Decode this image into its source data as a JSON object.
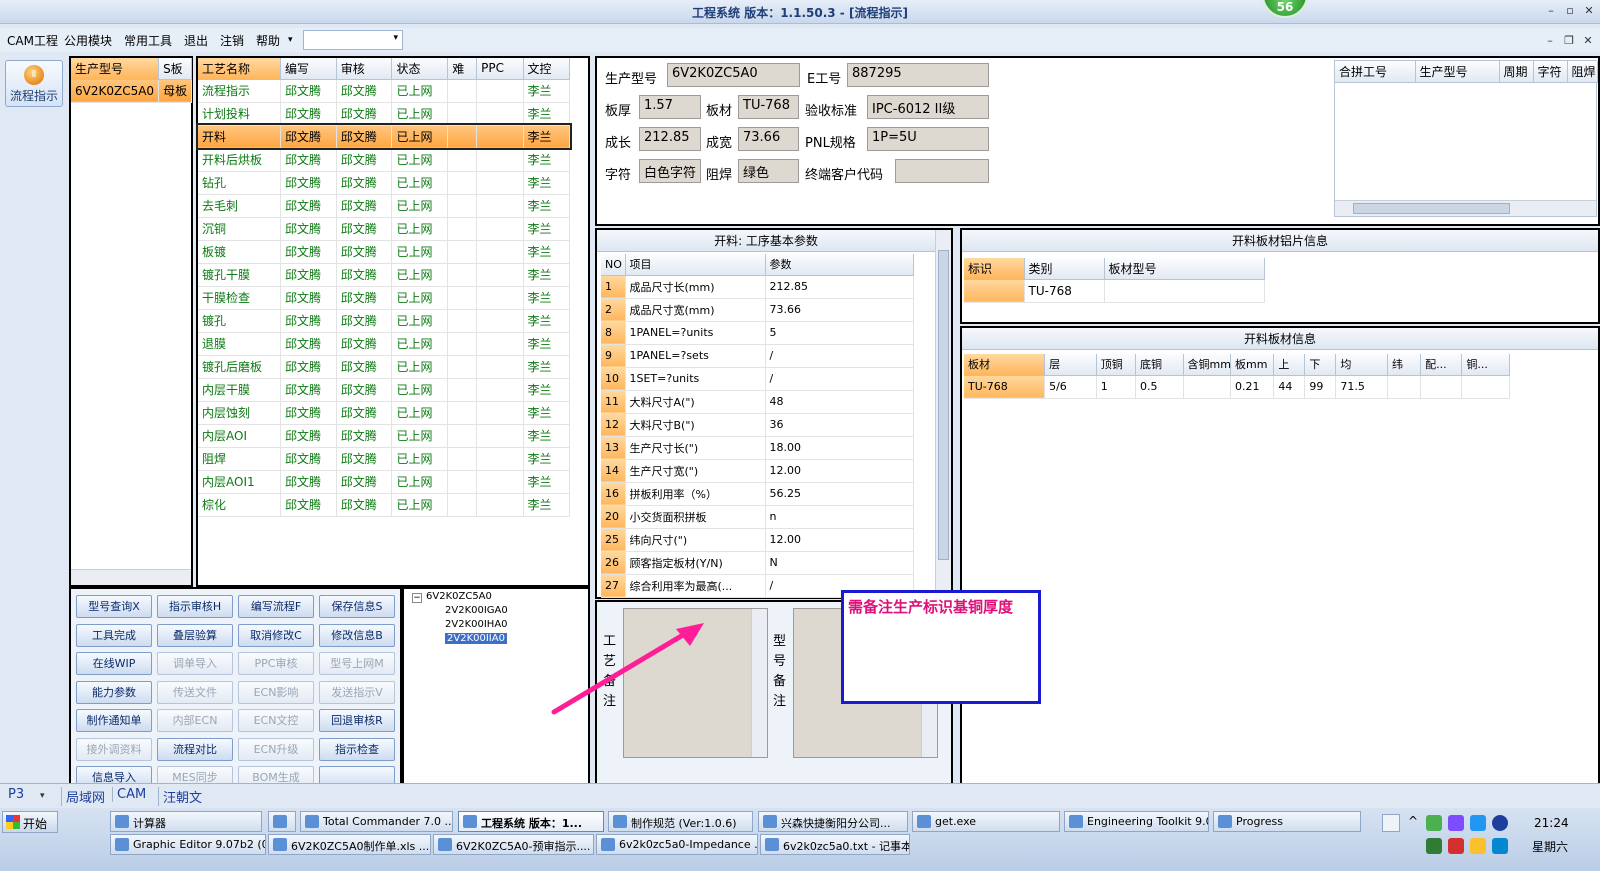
{
  "window": {
    "title": "工程系统  版本：1.1.50.3 - [流程指示]",
    "badge": "56",
    "min": "–",
    "max": "▫",
    "close": "✕",
    "inner_min": "–",
    "inner_restore": "❐",
    "inner_close": "✕"
  },
  "menu": [
    "CAM工程",
    "公用模块",
    "常用工具",
    "退出",
    "注销",
    "帮助"
  ],
  "menu_more": "▾",
  "combo": {
    "value": "",
    "arrow": "▾"
  },
  "side": {
    "label": "流程指示",
    "icon": "flow-icon"
  },
  "model_list": {
    "headers": [
      "生产型号",
      "S板"
    ],
    "rows": [
      [
        "6V2K0ZC5A0",
        "母板"
      ]
    ]
  },
  "process_table": {
    "headers": [
      "工艺名称",
      "编写",
      "审核",
      "状态",
      "难",
      "PPC",
      "文控"
    ],
    "rows": [
      [
        "流程指示",
        "邱文腾",
        "邱文腾",
        "已上网",
        "",
        "",
        "李兰"
      ],
      [
        "计划投料",
        "邱文腾",
        "邱文腾",
        "已上网",
        "",
        "",
        "李兰"
      ],
      [
        "开料",
        "邱文腾",
        "邱文腾",
        "已上网",
        "",
        "",
        "李兰"
      ],
      [
        "开料后烘板",
        "邱文腾",
        "邱文腾",
        "已上网",
        "",
        "",
        "李兰"
      ],
      [
        "钻孔",
        "邱文腾",
        "邱文腾",
        "已上网",
        "",
        "",
        "李兰"
      ],
      [
        "去毛刺",
        "邱文腾",
        "邱文腾",
        "已上网",
        "",
        "",
        "李兰"
      ],
      [
        "沉铜",
        "邱文腾",
        "邱文腾",
        "已上网",
        "",
        "",
        "李兰"
      ],
      [
        "板镀",
        "邱文腾",
        "邱文腾",
        "已上网",
        "",
        "",
        "李兰"
      ],
      [
        "镀孔干膜",
        "邱文腾",
        "邱文腾",
        "已上网",
        "",
        "",
        "李兰"
      ],
      [
        "干膜检查",
        "邱文腾",
        "邱文腾",
        "已上网",
        "",
        "",
        "李兰"
      ],
      [
        "镀孔",
        "邱文腾",
        "邱文腾",
        "已上网",
        "",
        "",
        "李兰"
      ],
      [
        "退膜",
        "邱文腾",
        "邱文腾",
        "已上网",
        "",
        "",
        "李兰"
      ],
      [
        "镀孔后磨板",
        "邱文腾",
        "邱文腾",
        "已上网",
        "",
        "",
        "李兰"
      ],
      [
        "内层干膜",
        "邱文腾",
        "邱文腾",
        "已上网",
        "",
        "",
        "李兰"
      ],
      [
        "内层蚀刻",
        "邱文腾",
        "邱文腾",
        "已上网",
        "",
        "",
        "李兰"
      ],
      [
        "内层AOI",
        "邱文腾",
        "邱文腾",
        "已上网",
        "",
        "",
        "李兰"
      ],
      [
        "阻焊",
        "邱文腾",
        "邱文腾",
        "已上网",
        "",
        "",
        "李兰"
      ],
      [
        "内层AOI1",
        "邱文腾",
        "邱文腾",
        "已上网",
        "",
        "",
        "李兰"
      ],
      [
        "棕化",
        "邱文腾",
        "邱文腾",
        "已上网",
        "",
        "",
        "李兰"
      ]
    ],
    "selected_index": 2
  },
  "buttons": [
    {
      "label": "型号查询X",
      "enabled": true
    },
    {
      "label": "指示审核H",
      "enabled": true
    },
    {
      "label": "编写流程F",
      "enabled": true
    },
    {
      "label": "保存信息S",
      "enabled": true
    },
    {
      "label": "工具完成",
      "enabled": true
    },
    {
      "label": "叠层验算",
      "enabled": true
    },
    {
      "label": "取消修改C",
      "enabled": true
    },
    {
      "label": "修改信息B",
      "enabled": true
    },
    {
      "label": "在线WIP",
      "enabled": true
    },
    {
      "label": "调单导入",
      "enabled": false
    },
    {
      "label": "PPC审核",
      "enabled": false
    },
    {
      "label": "型号上网M",
      "enabled": false
    },
    {
      "label": "能力参数",
      "enabled": true
    },
    {
      "label": "传送文件",
      "enabled": false
    },
    {
      "label": "ECN影响",
      "enabled": false
    },
    {
      "label": "发送指示V",
      "enabled": false
    },
    {
      "label": "制作通知单",
      "enabled": true
    },
    {
      "label": "内部ECN",
      "enabled": false
    },
    {
      "label": "ECN文控",
      "enabled": false
    },
    {
      "label": "回退审核R",
      "enabled": true
    },
    {
      "label": "接外调资料",
      "enabled": false
    },
    {
      "label": "流程对比",
      "enabled": true
    },
    {
      "label": "ECN升级",
      "enabled": false
    },
    {
      "label": "指示检查",
      "enabled": true
    },
    {
      "label": "信息导入",
      "enabled": true
    },
    {
      "label": "MES同步",
      "enabled": false
    },
    {
      "label": "BOM生成",
      "enabled": false
    },
    {
      "label": "",
      "enabled": true
    }
  ],
  "tree": {
    "root": "6V2K0ZC5A0",
    "children": [
      "2V2K00IGA0",
      "2V2K00IHA0",
      "2V2K00IIA0"
    ],
    "selected": 2,
    "toggle": "−"
  },
  "info": {
    "fields": [
      {
        "label": "生产型号",
        "value": "6V2K0ZC5A0"
      },
      {
        "label": "E工号",
        "value": "887295"
      },
      {
        "label": "板厚",
        "value": "1.57"
      },
      {
        "label": "板材",
        "value": "TU-768"
      },
      {
        "label": "验收标准",
        "value": "IPC-6012 II级"
      },
      {
        "label": "成长",
        "value": "212.85"
      },
      {
        "label": "成宽",
        "value": "73.66"
      },
      {
        "label": "PNL规格",
        "value": "1P=5U"
      },
      {
        "label": "字符",
        "value": "白色字符"
      },
      {
        "label": "阻焊",
        "value": "绿色"
      },
      {
        "label": "终端客户代码",
        "value": ""
      }
    ]
  },
  "merge_table": {
    "headers": [
      "合拼工号",
      "生产型号",
      "周期",
      "字符",
      "阻焊"
    ]
  },
  "params": {
    "title": "开料: 工序基本参数",
    "headers": [
      "NO",
      "项目",
      "参数"
    ],
    "rows": [
      [
        "1",
        "成品尺寸长(mm)",
        "212.85"
      ],
      [
        "2",
        "成品尺寸宽(mm)",
        "73.66"
      ],
      [
        "8",
        "1PANEL=?units",
        "5"
      ],
      [
        "9",
        "1PANEL=?sets",
        "/"
      ],
      [
        "10",
        "1SET=?units",
        "/"
      ],
      [
        "11",
        "大料尺寸A(\")",
        "48"
      ],
      [
        "12",
        "大料尺寸B(\")",
        "36"
      ],
      [
        "13",
        "生产尺寸长(\")",
        "18.00"
      ],
      [
        "14",
        "生产尺寸宽(\")",
        "12.00"
      ],
      [
        "16",
        "拼板利用率（%）",
        "56.25"
      ],
      [
        "20",
        "小交货面积拼板",
        "n"
      ],
      [
        "25",
        "纬向尺寸(\")",
        "12.00"
      ],
      [
        "26",
        "顾客指定板材(Y/N)",
        "N"
      ],
      [
        "27",
        "综合利用率为最高(...",
        "/"
      ]
    ]
  },
  "foil": {
    "title": "开料板材铝片信息",
    "headers": [
      "标识",
      "类别",
      "板材型号"
    ],
    "rows": [
      [
        "",
        "TU-768",
        ""
      ]
    ]
  },
  "sheet": {
    "title": "开料板材信息",
    "headers": [
      "板材",
      "层",
      "顶铜",
      "底铜",
      "含铜mm",
      "板mm",
      "上",
      "下",
      "均",
      "纬",
      "配...",
      "铜..."
    ],
    "rows": [
      [
        "TU-768",
        "5/6",
        "1",
        "0.5",
        "",
        "0.21",
        "44",
        "99",
        "71.5",
        "",
        "",
        ""
      ]
    ]
  },
  "remarks": {
    "process_label": "工艺备注",
    "model_label": "型号备注"
  },
  "annotation": "需备注生产标识基铜厚度",
  "status": {
    "page": "P3",
    "arrow": "▾",
    "items": [
      "局域网",
      "CAM",
      "汪朝文"
    ]
  },
  "taskbar": {
    "start": "开始",
    "row1": [
      "计算器",
      "",
      "Total Commander 7.0 ...",
      "工程系统  版本：1...",
      "制作规范 (Ver:1.0.6)",
      "兴森快捷衡阳分公司...",
      "get.exe",
      "Engineering Toolkit 9.0...",
      "Progress"
    ],
    "row2": [
      "Graphic Editor 9.07b2 (0...",
      "6V2K0ZC5A0制作单.xls ...",
      "6V2K0ZC5A0-预审指示....",
      "6v2k0zc5a0-Impedance ...",
      "6v2k0zc5a0.txt - 记事本"
    ],
    "clock": "21:24",
    "weekday": "星期六",
    "tray_up": "^"
  }
}
